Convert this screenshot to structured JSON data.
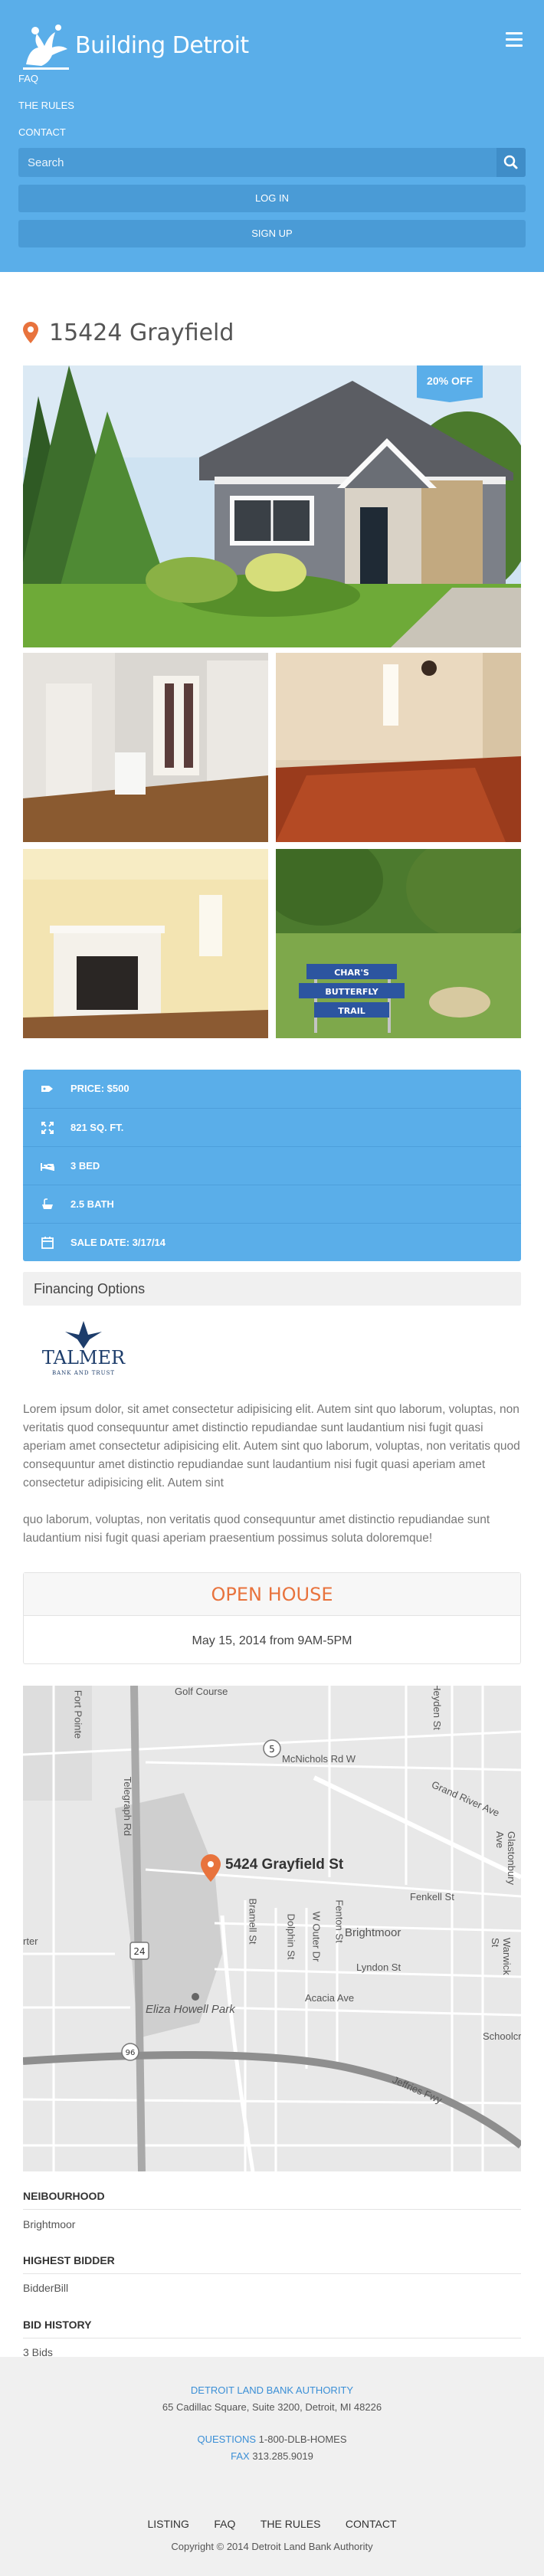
{
  "header": {
    "brand": "Building Detroit",
    "nav": [
      "FAQ",
      "THE RULES",
      "CONTACT"
    ],
    "search_placeholder": "Search",
    "login_label": "LOG IN",
    "signup_label": "SIGN UP"
  },
  "listing": {
    "title": "15424 Grayfield",
    "discount_badge": "20% OFF",
    "details": [
      {
        "icon": "tag-icon",
        "label": "PRICE: $500"
      },
      {
        "icon": "expand-icon",
        "label": "821 SQ. FT."
      },
      {
        "icon": "bed-icon",
        "label": "3 BED"
      },
      {
        "icon": "bath-icon",
        "label": "2.5 BATH"
      },
      {
        "icon": "calendar-icon",
        "label": "SALE DATE: 3/17/14"
      }
    ],
    "financing_label": "Financing Options",
    "sign_text": [
      "CHAR'S",
      "BUTTERFLY",
      "TRAIL"
    ],
    "lender_logo_text": "TALMER",
    "lender_logo_subtext": "BANK AND TRUST",
    "paragraph_1": "Lorem ipsum dolor, sit amet consectetur adipisicing elit. Autem sint quo laborum, voluptas, non veritatis quod consequuntur amet distinctio repudiandae sunt laudantium nisi fugit quasi aperiam amet consectetur adipisicing elit. Autem sint quo laborum, voluptas, non veritatis quod consequuntur amet distinctio repudiandae sunt laudantium nisi fugit quasi aperiam amet consectetur adipisicing elit. Autem sint",
    "paragraph_2": "quo laborum, voluptas, non veritatis quod consequuntur amet distinctio repudiandae sunt laudantium nisi fugit quasi aperiam praesentium possimus soluta doloremque!",
    "open_house_title": "OPEN HOUSE",
    "open_house_date": "May 15, 2014 from 9AM-5PM"
  },
  "map": {
    "pin_label": "5424 Grayfield St",
    "labels": [
      "Golf Course",
      "McNichols Rd W",
      "Grand River Ave",
      "Fenkell St",
      "Brightmoor",
      "Lyndon St",
      "Acacia Ave",
      "Eliza Howell Park",
      "Schoolcr",
      "Jeffries Fwy",
      "Telegraph Rd",
      "Fenton St",
      "Bramell St",
      "Dolphin St",
      "W Outer Dr",
      "Warwick St",
      "Glastonbury Ave",
      "Heyden St",
      "Fort Pointe",
      "rter"
    ],
    "shields": [
      "5",
      "24",
      "96"
    ]
  },
  "info": {
    "neighbourhood_label": "NEIBOURHOOD",
    "neighbourhood_value": "Brightmoor",
    "highest_bidder_label": "HIGHEST BIDDER",
    "highest_bidder_value": "BidderBill",
    "bid_history_label": "BID HISTORY",
    "bid_history_value": "3 Bids"
  },
  "footer": {
    "org": "DETROIT LAND BANK AUTHORITY",
    "address": "65 Cadillac Square, Suite 3200, Detroit, MI 48226",
    "questions_label": "QUESTIONS",
    "questions_phone": "1-800-DLB-HOMES",
    "fax_label": "FAX",
    "fax_phone": "313.285.9019",
    "nav": [
      "LISTING",
      "FAQ",
      "THE RULES",
      "CONTACT"
    ],
    "copyright": "Copyright © 2014 Detroit Land Bank Authority"
  },
  "colors": {
    "brand_blue": "#5aaee9",
    "accent_orange": "#e8733d",
    "footer_blue": "#3b8fd6"
  }
}
